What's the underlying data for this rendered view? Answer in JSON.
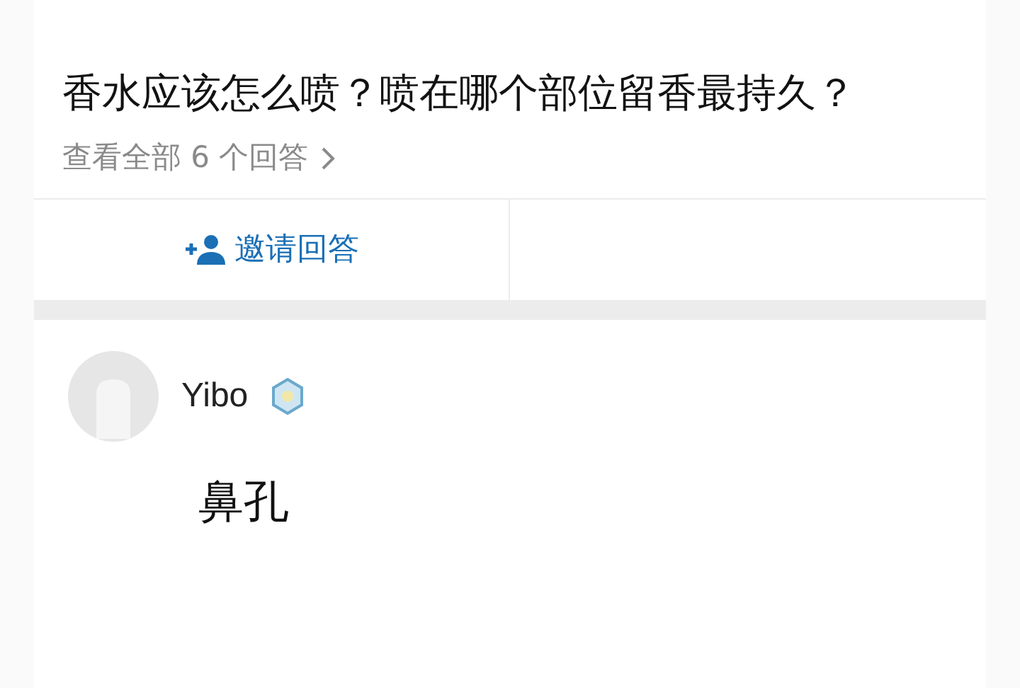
{
  "question": {
    "title": "香水应该怎么喷？喷在哪个部位留香最持久？",
    "view_all": "查看全部 6 个回答",
    "invite_button": "邀请回答"
  },
  "answer": {
    "author": "Yibo",
    "text": "鼻孔"
  }
}
